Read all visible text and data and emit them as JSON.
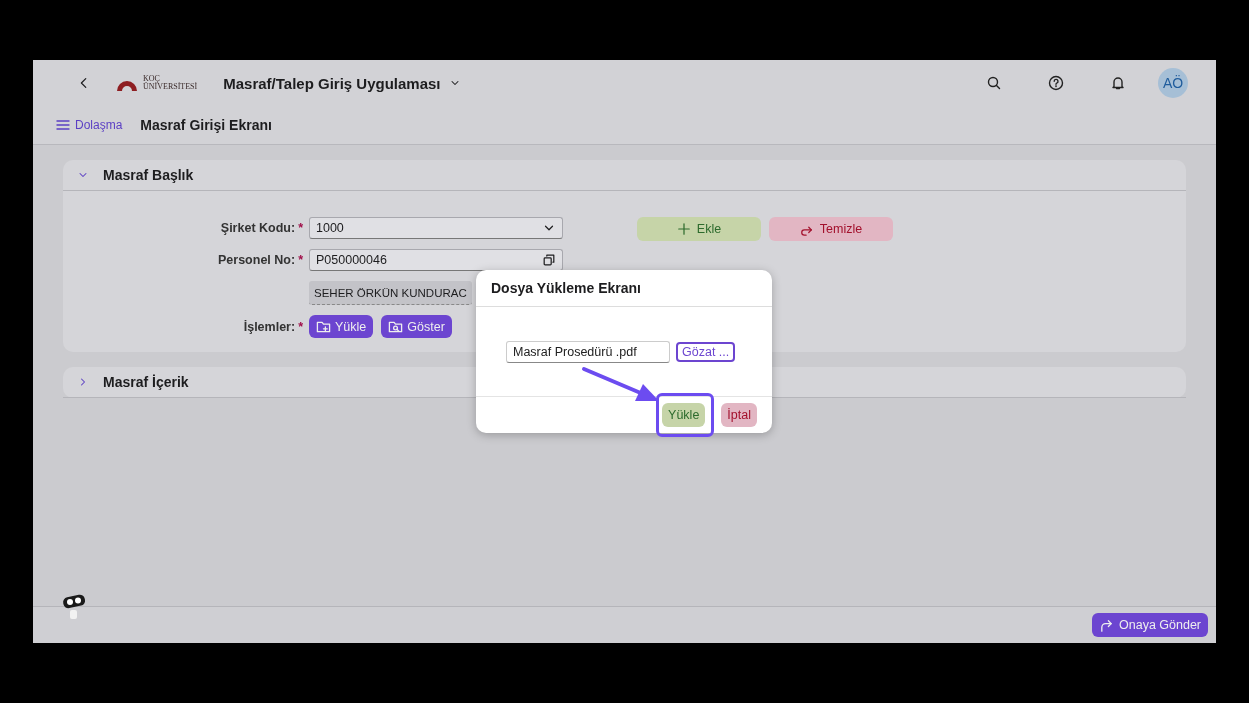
{
  "shell_bar": {
    "logo_lines": [
      "KOÇ",
      "ÜNİVERSİTESİ"
    ],
    "app_title": "Masraf/Talep Giriş Uygulaması",
    "avatar": "AÖ"
  },
  "sub_header": {
    "nav_label": "Dolaşma",
    "page_title": "Masraf Girişi Ekranı"
  },
  "sections": [
    {
      "title": "Masraf Başlık",
      "expanded": true
    },
    {
      "title": "Masraf İçerik",
      "expanded": false
    }
  ],
  "form": {
    "fields": [
      {
        "label": "Şirket Kodu:",
        "required_mark": "*",
        "kind": "select",
        "value": "1000"
      },
      {
        "label": "Personel No:",
        "required_mark": "*",
        "kind": "value-help",
        "value": "P050000046"
      },
      {
        "kind": "readonly",
        "value": "SEHER ÖRKÜN KUNDURAC"
      },
      {
        "label": "İşlemler:",
        "required_mark": "*",
        "kind": "buttons",
        "buttons": [
          {
            "label": "Yükle",
            "kind": "upload"
          },
          {
            "label": "Göster",
            "kind": "preview"
          }
        ]
      }
    ],
    "actions": [
      {
        "label": "Ekle",
        "kind": "accept"
      },
      {
        "label": "Temizle",
        "kind": "reject"
      }
    ]
  },
  "dialog": {
    "title": "Dosya Yükleme Ekranı",
    "file_value": "Masraf Prosedürü .pdf",
    "browse_label": "Gözat ...",
    "buttons": [
      {
        "label": "Yükle",
        "kind": "accept"
      },
      {
        "label": "İptal",
        "kind": "reject"
      }
    ]
  },
  "footer": {
    "submit_label": "Onaya Gönder"
  }
}
